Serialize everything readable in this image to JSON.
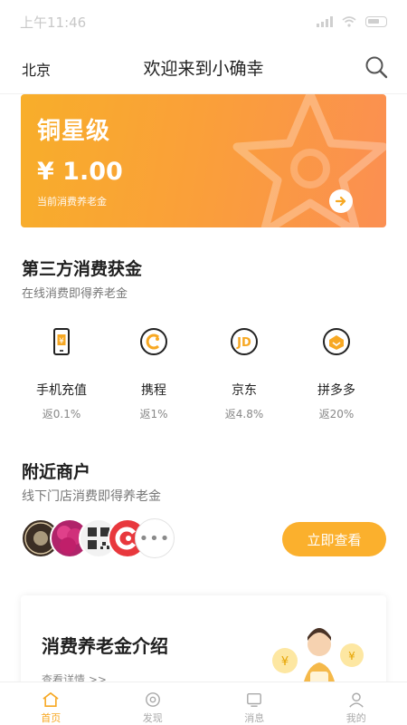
{
  "status_bar": {
    "time": "上午11:46"
  },
  "header": {
    "city": "北京",
    "title": "欢迎来到小确幸"
  },
  "card": {
    "level": "铜星级",
    "amount": "¥ 1.00",
    "caption": "当前消费养老金"
  },
  "third_party": {
    "title": "第三方消费获金",
    "subtitle": "在线消费即得养老金",
    "items": [
      {
        "name": "手机充值",
        "rate": "返0.1%",
        "icon": "phone-recharge-icon"
      },
      {
        "name": "携程",
        "rate": "返1%",
        "icon": "ctrip-icon"
      },
      {
        "name": "京东",
        "rate": "返4.8%",
        "icon": "jd-icon"
      },
      {
        "name": "拼多多",
        "rate": "返20%",
        "icon": "pinduoduo-icon"
      }
    ]
  },
  "nearby": {
    "title": "附近商户",
    "subtitle": "线下门店消费即得养老金",
    "button_label": "立即查看",
    "more_label": "•••"
  },
  "intro": {
    "title": "消费养老金介绍",
    "link": "查看详情 >>"
  },
  "tabs": [
    {
      "label": "首页",
      "active": true
    },
    {
      "label": "发现",
      "active": false
    },
    {
      "label": "消息",
      "active": false
    },
    {
      "label": "我的",
      "active": false
    }
  ],
  "colors": {
    "accent": "#f7a823",
    "card_start": "#f8ae2a",
    "card_end": "#fb8f52"
  }
}
